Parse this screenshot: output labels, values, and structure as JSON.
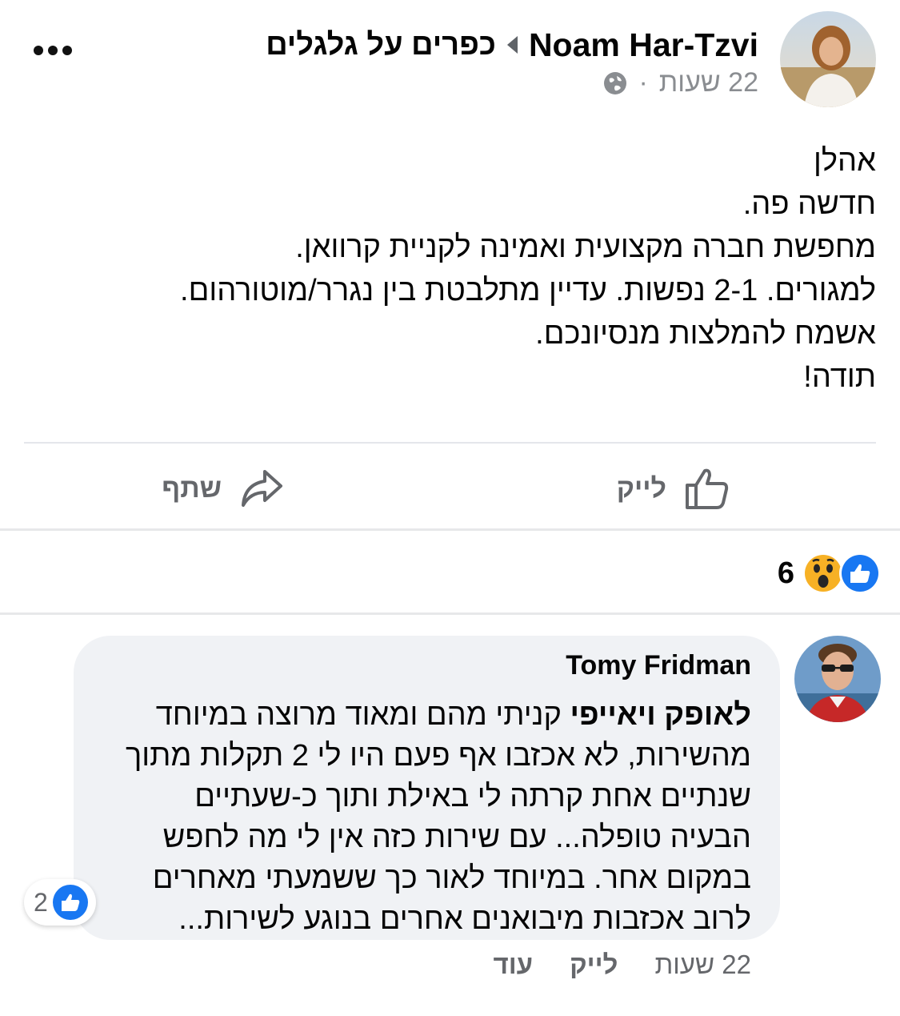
{
  "post": {
    "author": "Noam Har-Tzvi",
    "group": "כפרים על גלגלים",
    "time": "22 שעות",
    "separator": "·",
    "privacy_icon": "globe-icon",
    "body_lines": [
      "אהלן",
      "חדשה פה.",
      "מחפשת חברה מקצועית ואמינה לקניית קרוואן.",
      "למגורים. 2-1 נפשות.  עדיין מתלבטת בין נגרר/מוטורהום.",
      "אשמח להמלצות מנסיונכם.",
      "תודה!"
    ]
  },
  "actions": {
    "like": "לייק",
    "share": "שתף"
  },
  "reactions": {
    "types": [
      "like-icon",
      "wow-icon"
    ],
    "count": "6"
  },
  "comment": {
    "author": "Tomy Fridman",
    "mention": "לאופק ויאייפי",
    "lines": [
      "קניתי מהם ומאוד מרוצה במיוחד",
      "מהשירות, לא אכזבו אף פעם היו לי 2 תקלות מתוך",
      "שנתיים אחת קרתה לי באילת ותוך כ-שעתיים",
      "הבעיה טופלה... עם שירות כזה אין לי מה לחפש",
      "במקום אחר. במיוחד לאור כך ששמעתי מאחרים",
      "לרוב אכזבות מיבואנים אחרים בנוגע לשירות..."
    ],
    "like_count": "2",
    "time": "22 שעות",
    "like_action": "לייק",
    "more_action": "עוד"
  },
  "colors": {
    "primary_blue": "#1877f2",
    "text_secondary": "#65676b",
    "bubble_bg": "#f0f2f5",
    "wow_yellow": "#f7b125"
  }
}
